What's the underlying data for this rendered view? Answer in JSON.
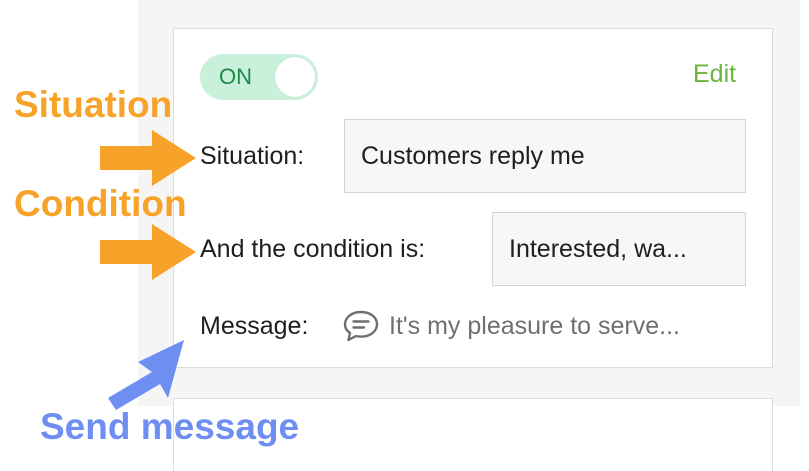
{
  "toggle": {
    "label": "ON",
    "state": "on",
    "color": "#c9f0da",
    "text_color": "#1d8a4a"
  },
  "edit_label": "Edit",
  "fields": {
    "situation": {
      "label": "Situation:",
      "value": "Customers reply me"
    },
    "condition": {
      "label": "And the condition is:",
      "value": "Interested, wa..."
    },
    "message": {
      "label": "Message:",
      "icon": "chat-bubble-icon",
      "value": "It's my pleasure to serve..."
    }
  },
  "annotations": {
    "situation": "Situation",
    "condition": "Condition",
    "send_message": "Send message"
  },
  "colors": {
    "annotation_orange": "#f7a228",
    "annotation_blue": "#6f8ef2",
    "edit_green": "#6ab53b"
  }
}
